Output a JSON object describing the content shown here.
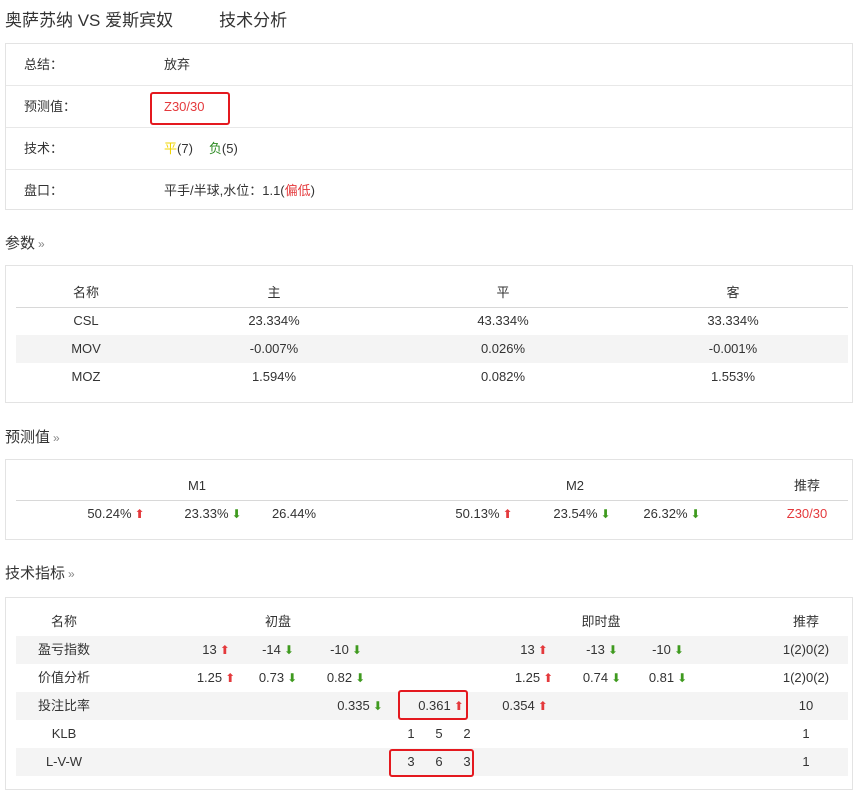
{
  "header": {
    "teams": "奥萨苏纳 VS 爱斯宾奴",
    "subtitle": "技术分析"
  },
  "summary": {
    "conclusion_label": "总结：",
    "conclusion_value": "放弃",
    "prediction_label": "预测值：",
    "prediction_value": "Z30/30",
    "tech_label": "技术：",
    "tech_draw": "平",
    "tech_draw_count": "(7)",
    "tech_loss": "负",
    "tech_loss_count": "(5)",
    "handicap_label": "盘口：",
    "handicap_value": "平手/半球,水位：1.1(",
    "handicap_note": "偏低",
    "handicap_close": ")"
  },
  "params": {
    "title": "参数",
    "headers": [
      "名称",
      "主",
      "平",
      "客"
    ],
    "rows": [
      [
        "CSL",
        "23.334%",
        "43.334%",
        "33.334%"
      ],
      [
        "MOV",
        "-0.007%",
        "0.026%",
        "-0.001%"
      ],
      [
        "MOZ",
        "1.594%",
        "0.082%",
        "1.553%"
      ]
    ]
  },
  "prediction": {
    "title": "预测值",
    "m1_label": "M1",
    "m2_label": "M2",
    "rec_label": "推荐",
    "m1": [
      {
        "v": "50.24%",
        "dir": "up"
      },
      {
        "v": "23.33%",
        "dir": "down"
      },
      {
        "v": "26.44%",
        "dir": ""
      }
    ],
    "m2": [
      {
        "v": "50.13%",
        "dir": "up"
      },
      {
        "v": "23.54%",
        "dir": "down"
      },
      {
        "v": "26.32%",
        "dir": "down"
      }
    ],
    "rec": "Z30/30"
  },
  "tech": {
    "title": "技术指标",
    "headers": {
      "name": "名称",
      "initial": "初盘",
      "live": "即时盘",
      "rec": "推荐"
    },
    "rows": [
      {
        "name": "盈亏指数",
        "init": [
          {
            "v": "13",
            "dir": "up"
          },
          {
            "v": "-14",
            "dir": "down"
          },
          {
            "v": "-10",
            "dir": "down"
          }
        ],
        "live": [
          {
            "v": "13",
            "dir": "up"
          },
          {
            "v": "-13",
            "dir": "down"
          },
          {
            "v": "-10",
            "dir": "down"
          }
        ],
        "rec": "1(2)0(2)"
      },
      {
        "name": "价值分析",
        "init": [
          {
            "v": "1.25",
            "dir": "up"
          },
          {
            "v": "0.73",
            "dir": "down"
          },
          {
            "v": "0.82",
            "dir": "down"
          }
        ],
        "live": [
          {
            "v": "1.25",
            "dir": "up"
          },
          {
            "v": "0.74",
            "dir": "down"
          },
          {
            "v": "0.81",
            "dir": "down"
          }
        ],
        "rec": "1(2)0(2)"
      },
      {
        "name": "投注比率",
        "vals": [
          {
            "v": "0.335",
            "dir": "down"
          },
          {
            "v": "0.361",
            "dir": "up"
          },
          {
            "v": "0.354",
            "dir": "up"
          }
        ],
        "rec": "10"
      },
      {
        "name": "KLB",
        "digits": [
          "1",
          "5",
          "2"
        ],
        "rec": "1"
      },
      {
        "name": "L-V-W",
        "digits": [
          "3",
          "6",
          "3"
        ],
        "rec": "1"
      }
    ]
  }
}
